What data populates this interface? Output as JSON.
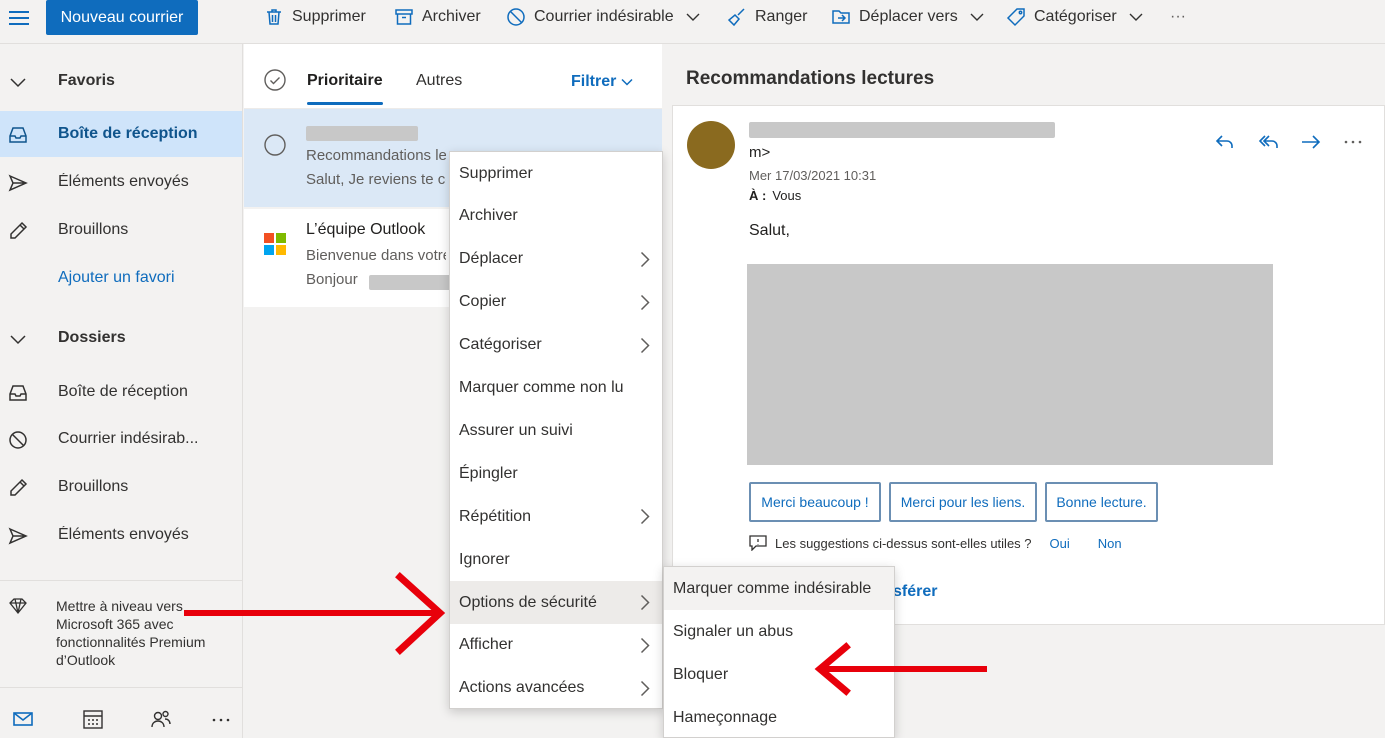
{
  "toolbar": {
    "new_mail": "Nouveau courrier",
    "delete": "Supprimer",
    "archive": "Archiver",
    "junk": "Courrier indésirable",
    "sweep": "Ranger",
    "move_to": "Déplacer vers",
    "categorize": "Catégoriser",
    "more": "···"
  },
  "sidebar": {
    "favorites_header": "Favoris",
    "favorites": [
      {
        "label": "Boîte de réception",
        "icon": "inbox-icon"
      },
      {
        "label": "Éléments envoyés",
        "icon": "send-icon"
      },
      {
        "label": "Brouillons",
        "icon": "pencil-icon"
      }
    ],
    "add_favorite": "Ajouter un favori",
    "folders_header": "Dossiers",
    "folders": [
      {
        "label": "Boîte de réception",
        "icon": "inbox-icon"
      },
      {
        "label": "Courrier indésirab...",
        "icon": "blocked-icon"
      },
      {
        "label": "Brouillons",
        "icon": "pencil-icon"
      },
      {
        "label": "Éléments envoyés",
        "icon": "send-icon"
      }
    ],
    "upgrade_text": "Mettre à niveau vers Microsoft 365 avec fonctionnalités Premium d’Outlook"
  },
  "message_list": {
    "tab_focused": "Prioritaire",
    "tab_other": "Autres",
    "filter": "Filtrer",
    "messages": [
      {
        "sender": "",
        "subject": "Recommandations lectures",
        "preview": "Salut, Je reviens te contacter"
      },
      {
        "sender": "L’équipe Outlook",
        "subject": "Bienvenue dans votre boîte",
        "preview": "Bonjour"
      }
    ]
  },
  "reading_pane": {
    "title": "Recommandations lectures",
    "from_fragment": "m>",
    "date": "Mer 17/03/2021 10:31",
    "to_label": "À :",
    "to_value": "Vous",
    "greeting": "Salut,",
    "suggestions": [
      "Merci beaucoup !",
      "Merci pour les liens.",
      "Bonne lecture."
    ],
    "useful_question": "Les suggestions ci-dessus sont-elles utiles ?",
    "yes": "Oui",
    "no": "Non",
    "forward_fragment": "sférer"
  },
  "context_menu": {
    "items": [
      {
        "label": "Supprimer",
        "submenu": false
      },
      {
        "label": "Archiver",
        "submenu": false
      },
      {
        "label": "Déplacer",
        "submenu": true
      },
      {
        "label": "Copier",
        "submenu": true
      },
      {
        "label": "Catégoriser",
        "submenu": true
      },
      {
        "label": "Marquer comme non lu",
        "submenu": false
      },
      {
        "label": "Assurer un suivi",
        "submenu": false
      },
      {
        "label": "Épingler",
        "submenu": false
      },
      {
        "label": "Répétition",
        "submenu": true
      },
      {
        "label": "Ignorer",
        "submenu": false
      },
      {
        "label": "Options de sécurité",
        "submenu": true
      },
      {
        "label": "Afficher",
        "submenu": true
      },
      {
        "label": "Actions avancées",
        "submenu": true
      }
    ],
    "security_submenu": [
      "Marquer comme indésirable",
      "Signaler un abus",
      "Bloquer",
      "Hameçonnage"
    ]
  },
  "colors": {
    "accent": "#0f6cbd",
    "selected_nav": "#cfe4fa",
    "annotation_arrow": "#e8000b",
    "avatar": "#8a6a1f"
  }
}
